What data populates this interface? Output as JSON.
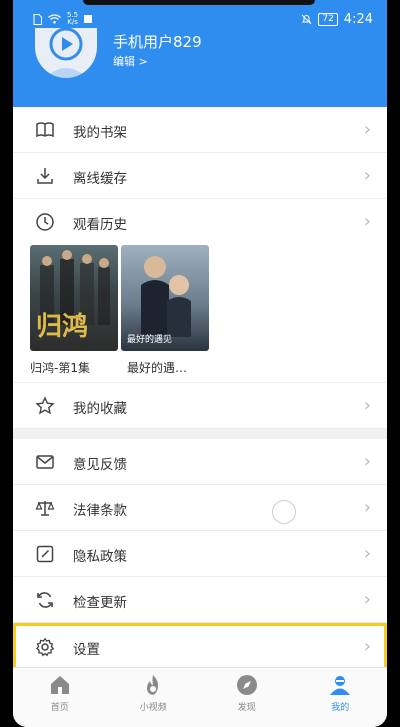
{
  "status_bar": {
    "network_speed_value": "5.5",
    "network_speed_unit": "K/s",
    "battery": "72",
    "time": "4:24"
  },
  "profile": {
    "user_name": "手机用户829",
    "edit_label": "编辑 >"
  },
  "menu_top": [
    {
      "label": "我的书架",
      "icon": "book-icon"
    },
    {
      "label": "离线缓存",
      "icon": "download-icon"
    },
    {
      "label": "观看历史",
      "icon": "clock-icon"
    }
  ],
  "history": [
    {
      "caption": "归鸿-第1集",
      "poster_text": "归鸿"
    },
    {
      "caption": "最好的遇…",
      "poster_text": "最好的遇见"
    }
  ],
  "favorites_label": "我的收藏",
  "menu_bottom": [
    {
      "label": "意见反馈",
      "icon": "mail-icon"
    },
    {
      "label": "法律条款",
      "icon": "scale-icon"
    },
    {
      "label": "隐私政策",
      "icon": "edit-square-icon"
    },
    {
      "label": "检查更新",
      "icon": "refresh-icon"
    },
    {
      "label": "设置",
      "icon": "gear-icon"
    }
  ],
  "chevron": "›",
  "bottom_nav": [
    {
      "label": "首页",
      "icon": "home-icon"
    },
    {
      "label": "小视频",
      "icon": "flame-icon"
    },
    {
      "label": "发现",
      "icon": "compass-icon"
    },
    {
      "label": "我的",
      "icon": "user-icon",
      "active": true
    }
  ],
  "colors": {
    "accent": "#2f8df0",
    "highlight_border": "#f3cd1f"
  }
}
